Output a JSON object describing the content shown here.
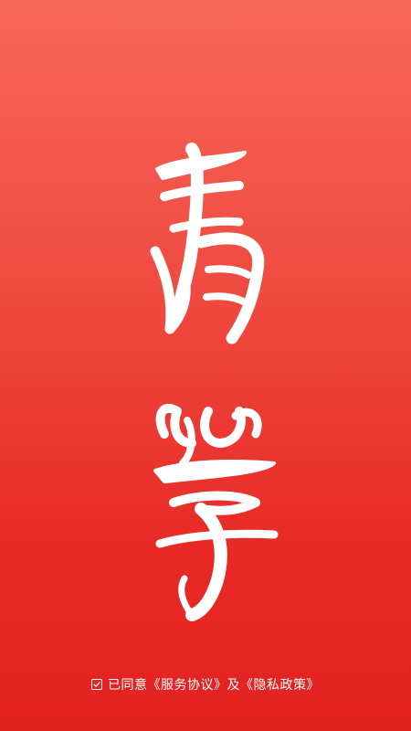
{
  "app": {
    "logo_text": "青學"
  },
  "agreement": {
    "checked": true,
    "prefix": "已同意",
    "service_link": "《服务协议》",
    "joiner": "及",
    "privacy_link": "《隐私政策》"
  },
  "colors": {
    "background_top": "#f8675a",
    "background_bottom": "#e32222",
    "foreground": "#ffffff"
  },
  "icons": {
    "checkbox": "checkbox-checked-icon"
  }
}
